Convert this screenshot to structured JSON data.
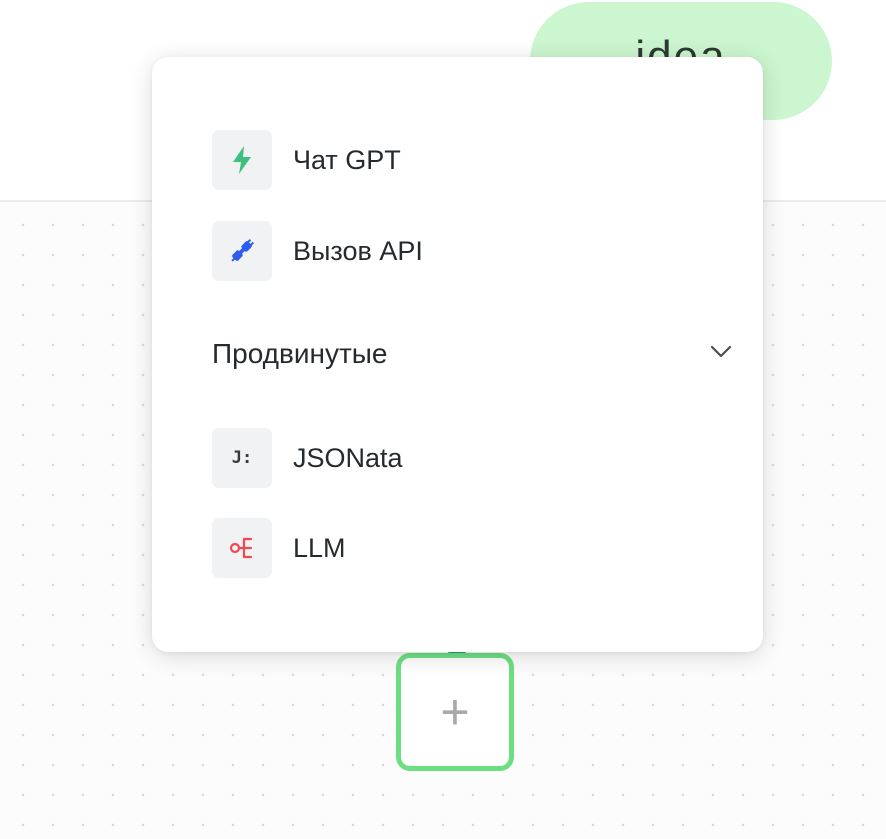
{
  "idea_node": {
    "label": "idea"
  },
  "menu": {
    "items": [
      {
        "label": "Чат GPT",
        "icon": "lightning-icon",
        "icon_color": "#3fbf7f"
      },
      {
        "label": "Вызов API",
        "icon": "plug-icon",
        "icon_color": "#2e5bf0"
      }
    ],
    "section": {
      "title": "Продвинутые",
      "items": [
        {
          "label": "JSONata",
          "icon": "jsonata-icon",
          "icon_glyph": "J:",
          "icon_color": "#3a3a3a"
        },
        {
          "label": "LLM",
          "icon": "llm-icon",
          "icon_color": "#f0494f"
        }
      ]
    }
  },
  "add_node": {
    "symbol": "+",
    "accent": "#6ddf83"
  }
}
